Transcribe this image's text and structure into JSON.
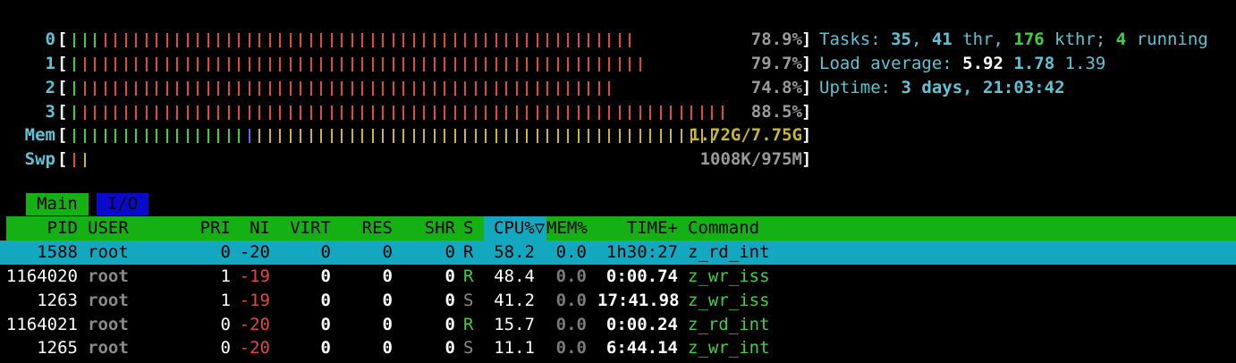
{
  "meters": [
    {
      "label": "0",
      "value": "78.9%",
      "bars": [
        {
          "color": "#3fd23f",
          "count": 3
        },
        {
          "color": "#e04a3a",
          "count": 52
        }
      ]
    },
    {
      "label": "1",
      "value": "79.7%",
      "bars": [
        {
          "color": "#3fd23f",
          "count": 1
        },
        {
          "color": "#e04a3a",
          "count": 55
        }
      ]
    },
    {
      "label": "2",
      "value": "74.8%",
      "bars": [
        {
          "color": "#3fd23f",
          "count": 1
        },
        {
          "color": "#e04a3a",
          "count": 52
        }
      ]
    },
    {
      "label": "3",
      "value": "88.5%",
      "bars": [
        {
          "color": "#3fd23f",
          "count": 1
        },
        {
          "color": "#e04a3a",
          "count": 63
        }
      ]
    },
    {
      "label": "Mem",
      "value": "1.72G/7.75G",
      "bars": [
        {
          "color": "#3fd23f",
          "count": 17
        },
        {
          "color": "#6a5cff",
          "count": 1
        },
        {
          "color": "#c8b82a",
          "count": 45
        }
      ]
    },
    {
      "label": "Swp",
      "value": "1008K/975M",
      "bars": [
        {
          "color": "#e04a3a",
          "count": 1
        },
        {
          "color": "#c8b82a",
          "count": 1
        }
      ]
    }
  ],
  "info": {
    "tasks_label": "Tasks: ",
    "tasks": "35",
    "sep1": ", ",
    "thr": "41",
    "thr_label": " thr, ",
    "kthr": "176",
    "kthr_label": " kthr; ",
    "running": "4",
    "running_label": " running",
    "load_label": "Load average: ",
    "load1": "5.92",
    "load5": "1.78",
    "load15": "1.39",
    "uptime_label": "Uptime: ",
    "uptime": "3 days, 21:03:42"
  },
  "tabs": [
    {
      "label": "Main",
      "active": true
    },
    {
      "label": "I/O",
      "active": false
    }
  ],
  "columns": {
    "pid": "PID",
    "user": "USER",
    "pri": "PRI",
    "ni": "NI",
    "virt": "VIRT",
    "res": "RES",
    "shr": "SHR",
    "s": "S",
    "cpu": "CPU%▽",
    "mem": "MEM%",
    "time": "TIME+",
    "command": "Command"
  },
  "processes": [
    {
      "pid": "1588",
      "user": "root",
      "pri": "0",
      "ni": "-20",
      "virt": "0",
      "res": "0",
      "shr": "0",
      "s": "R",
      "cpu": "58.2",
      "mem": "0.0",
      "time": "1h30:27",
      "command": "z_rd_int"
    },
    {
      "pid": "1164020",
      "user": "root",
      "pri": "1",
      "ni": "-19",
      "virt": "0",
      "res": "0",
      "shr": "0",
      "s": "R",
      "cpu": "48.4",
      "mem": "0.0",
      "time": "0:00.74",
      "command": "z_wr_iss"
    },
    {
      "pid": "1263",
      "user": "root",
      "pri": "1",
      "ni": "-19",
      "virt": "0",
      "res": "0",
      "shr": "0",
      "s": "S",
      "cpu": "41.2",
      "mem": "0.0",
      "time": "17:41.98",
      "command": "z_wr_iss"
    },
    {
      "pid": "1164021",
      "user": "root",
      "pri": "0",
      "ni": "-20",
      "virt": "0",
      "res": "0",
      "shr": "0",
      "s": "R",
      "cpu": "15.7",
      "mem": "0.0",
      "time": "0:00.24",
      "command": "z_rd_int"
    },
    {
      "pid": "1265",
      "user": "root",
      "pri": "0",
      "ni": "-20",
      "virt": "0",
      "res": "0",
      "shr": "0",
      "s": "S",
      "cpu": "11.1",
      "mem": "0.0",
      "time": "6:44.14",
      "command": "z_wr_int"
    }
  ]
}
